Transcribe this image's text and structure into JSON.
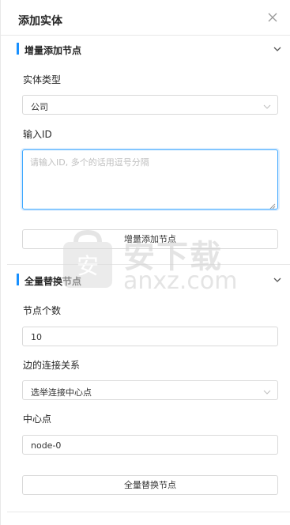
{
  "header": {
    "title": "添加实体",
    "close_icon": "close-icon"
  },
  "section_incremental": {
    "title": "增量添加节点",
    "entity_type_label": "实体类型",
    "entity_type_value": "公司",
    "id_label": "输入ID",
    "id_placeholder": "请输入ID, 多个的话用逗号分隔",
    "submit_label": "增量添加节点"
  },
  "section_replace": {
    "title": "全量替换节点",
    "node_count_label": "节点个数",
    "node_count_value": "10",
    "edge_label": "边的连接关系",
    "edge_value": "选举连接中心点",
    "center_label": "中心点",
    "center_value": "node-0",
    "submit_label": "全量替换节点"
  },
  "watermark": {
    "text_cn": "安下载",
    "text_en": "anxz.com"
  },
  "colors": {
    "accent": "#1890ff",
    "border": "#d9d9d9",
    "placeholder": "#bfbfbf"
  }
}
